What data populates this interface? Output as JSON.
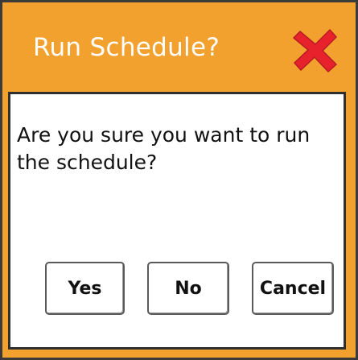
{
  "dialog": {
    "title": "Run Schedule?",
    "close_icon": "close-x-icon",
    "message": "Are you sure you want to run the schedule?",
    "buttons": {
      "yes": "Yes",
      "no": "No",
      "cancel": "Cancel"
    }
  },
  "colors": {
    "titlebar": "#f2a12e",
    "close_icon": "#e8222d",
    "border": "#3a3a3a"
  }
}
